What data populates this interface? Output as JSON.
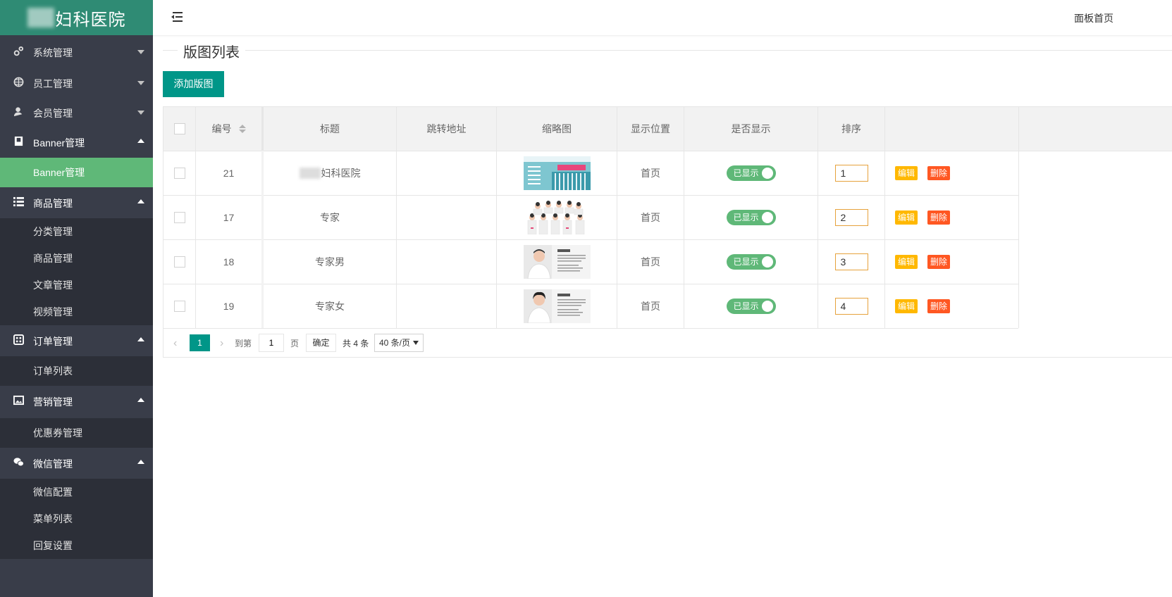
{
  "logo": {
    "text": "妇科医院"
  },
  "header": {
    "right_link": "面板首页"
  },
  "sidebar": {
    "groups": [
      {
        "label": "系统管理",
        "icon": "gears-icon",
        "expanded": false,
        "items": []
      },
      {
        "label": "员工管理",
        "icon": "globe-icon",
        "expanded": false,
        "items": []
      },
      {
        "label": "会员管理",
        "icon": "user-icon",
        "expanded": false,
        "items": []
      },
      {
        "label": "Banner管理",
        "icon": "book-icon",
        "expanded": true,
        "items": [
          {
            "label": "Banner管理",
            "active": true
          }
        ]
      },
      {
        "label": "商品管理",
        "icon": "list-icon",
        "expanded": true,
        "items": [
          {
            "label": "分类管理"
          },
          {
            "label": "商品管理"
          },
          {
            "label": "文章管理"
          },
          {
            "label": "视频管理"
          }
        ]
      },
      {
        "label": "订单管理",
        "icon": "order-icon",
        "expanded": true,
        "items": [
          {
            "label": "订单列表"
          }
        ]
      },
      {
        "label": "营销管理",
        "icon": "picture-icon",
        "expanded": true,
        "items": [
          {
            "label": "优惠券管理"
          }
        ]
      },
      {
        "label": "微信管理",
        "icon": "wechat-icon",
        "expanded": true,
        "items": [
          {
            "label": "微信配置"
          },
          {
            "label": "菜单列表"
          },
          {
            "label": "回复设置"
          }
        ]
      }
    ]
  },
  "main": {
    "title": "版图列表",
    "add_button": "添加版图",
    "table": {
      "headers": {
        "id": "编号",
        "title": "标题",
        "url": "跳转地址",
        "thumb": "缩略图",
        "position": "显示位置",
        "show": "是否显示",
        "sort": "排序"
      },
      "rows": [
        {
          "id": "21",
          "title": "妇科医院",
          "url": "",
          "thumb": "hospital-banner",
          "position": "首页",
          "show": "已显示",
          "sort": "1",
          "edit": "编辑",
          "delete": "删除"
        },
        {
          "id": "17",
          "title": "专家",
          "url": "",
          "thumb": "experts-group",
          "position": "首页",
          "show": "已显示",
          "sort": "2",
          "edit": "编辑",
          "delete": "删除"
        },
        {
          "id": "18",
          "title": "专家男",
          "url": "",
          "thumb": "doctor-male",
          "position": "首页",
          "show": "已显示",
          "sort": "3",
          "edit": "编辑",
          "delete": "删除"
        },
        {
          "id": "19",
          "title": "专家女",
          "url": "",
          "thumb": "doctor-female",
          "position": "首页",
          "show": "已显示",
          "sort": "4",
          "edit": "编辑",
          "delete": "删除"
        }
      ]
    },
    "pager": {
      "current": "1",
      "goto_label": "到第",
      "goto_value": "1",
      "page_label": "页",
      "confirm": "确定",
      "total": "共 4 条",
      "per_page": "40 条/页"
    }
  },
  "colors": {
    "sidebar": "#393d49",
    "logo_bg": "#2f8b74",
    "primary": "#009688",
    "active": "#5fb878",
    "edit": "#ffb800",
    "delete": "#ff5722"
  }
}
